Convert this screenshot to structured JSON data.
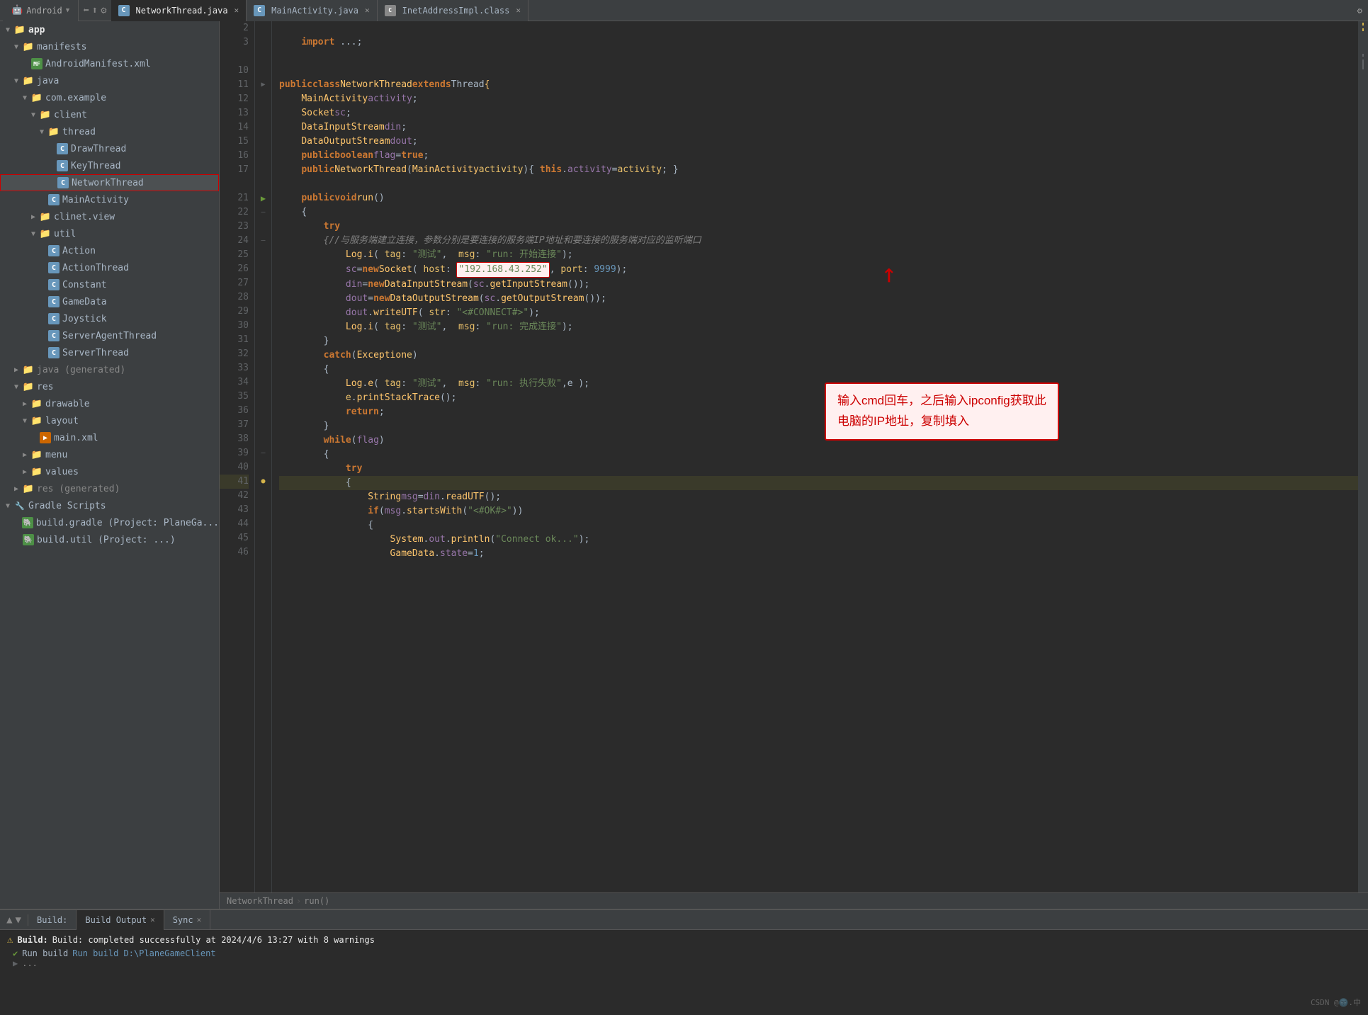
{
  "tabs": [
    {
      "label": "NetworkThread.java",
      "active": true,
      "icon": "java"
    },
    {
      "label": "MainActivity.java",
      "active": false,
      "icon": "java"
    },
    {
      "label": "InetAddressImpl.class",
      "active": false,
      "icon": "class"
    }
  ],
  "sidebar": {
    "title": "Android",
    "items": [
      {
        "level": 1,
        "type": "folder",
        "label": "app",
        "open": true,
        "bold": true
      },
      {
        "level": 2,
        "type": "folder",
        "label": "manifests",
        "open": true
      },
      {
        "level": 3,
        "type": "manifest",
        "label": "AndroidManifest.xml"
      },
      {
        "level": 2,
        "type": "folder",
        "label": "java",
        "open": true
      },
      {
        "level": 3,
        "type": "folder",
        "label": "com.example",
        "open": true
      },
      {
        "level": 4,
        "type": "folder",
        "label": "client",
        "open": true
      },
      {
        "level": 5,
        "type": "folder",
        "label": "thread",
        "open": true
      },
      {
        "level": 6,
        "type": "c",
        "label": "DrawThread"
      },
      {
        "level": 6,
        "type": "c",
        "label": "KeyThread"
      },
      {
        "level": 6,
        "type": "c",
        "label": "NetworkThread",
        "selected": true
      },
      {
        "level": 5,
        "type": "c",
        "label": "MainActivity"
      },
      {
        "level": 4,
        "type": "folder",
        "label": "clinet.view",
        "open": false
      },
      {
        "level": 4,
        "type": "folder",
        "label": "util",
        "open": true
      },
      {
        "level": 5,
        "type": "c",
        "label": "Action"
      },
      {
        "level": 5,
        "type": "c",
        "label": "ActionThread"
      },
      {
        "level": 5,
        "type": "c",
        "label": "Constant"
      },
      {
        "level": 5,
        "type": "c",
        "label": "GameData"
      },
      {
        "level": 5,
        "type": "c",
        "label": "Joystick"
      },
      {
        "level": 5,
        "type": "c",
        "label": "ServerAgentThread"
      },
      {
        "level": 5,
        "type": "c",
        "label": "ServerThread"
      },
      {
        "level": 2,
        "type": "folder",
        "label": "java (generated)",
        "open": false,
        "gray": true
      },
      {
        "level": 2,
        "type": "folder",
        "label": "res",
        "open": true
      },
      {
        "level": 3,
        "type": "folder",
        "label": "drawable",
        "open": false
      },
      {
        "level": 3,
        "type": "folder",
        "label": "layout",
        "open": true
      },
      {
        "level": 4,
        "type": "xml",
        "label": "main.xml"
      },
      {
        "level": 3,
        "type": "folder",
        "label": "menu",
        "open": false
      },
      {
        "level": 3,
        "type": "folder",
        "label": "values",
        "open": false
      },
      {
        "level": 2,
        "type": "folder",
        "label": "res (generated)",
        "open": false,
        "gray": true
      },
      {
        "level": 1,
        "type": "folder",
        "label": "Gradle Scripts",
        "open": true
      },
      {
        "level": 2,
        "type": "gradle",
        "label": "build.gradle (Project: PlaneGa..."
      },
      {
        "level": 2,
        "type": "gradle",
        "label": "build.util (Project: ...)"
      }
    ]
  },
  "code": {
    "filename": "NetworkThread.java",
    "lines": [
      {
        "n": 2,
        "text": ""
      },
      {
        "n": 3,
        "text": "    import ...;"
      },
      {
        "n": 10,
        "text": ""
      },
      {
        "n": 11,
        "text": "public class NetworkThread extends Thread{"
      },
      {
        "n": 12,
        "text": "    MainActivity activity;"
      },
      {
        "n": 13,
        "text": "    Socket sc;"
      },
      {
        "n": 14,
        "text": "    DataInputStream din;"
      },
      {
        "n": 15,
        "text": "    DataOutputStream dout;"
      },
      {
        "n": 16,
        "text": "    public boolean flag=true;"
      },
      {
        "n": 17,
        "text": "    public NetworkThread(MainActivity activity) { this.activity=activity; }"
      },
      {
        "n": 21,
        "text": "    public void run()"
      },
      {
        "n": 22,
        "text": "    {"
      },
      {
        "n": 23,
        "text": "        try"
      },
      {
        "n": 24,
        "text": "        {//与服务端建立连接，参数分别是要连接的服务端IP地址和要连接的服务端对应的监听端口"
      },
      {
        "n": 25,
        "text": "            Log.i( tag: \"测试\",  msg: \"run: 开始连接\");"
      },
      {
        "n": 26,
        "text": "            sc=new Socket( host: \"192.168.43.252\", port: 9999);"
      },
      {
        "n": 27,
        "text": "            din=new DataInputStream(sc.getInputStream());"
      },
      {
        "n": 28,
        "text": "            dout=new DataOutputStream(sc.getOutputStream());"
      },
      {
        "n": 29,
        "text": "            dout.writeUTF( str: \"<#CONNECT#>\");"
      },
      {
        "n": 30,
        "text": "            Log.i( tag: \"测试\",  msg: \"run: 完成连接\");"
      },
      {
        "n": 31,
        "text": "        }"
      },
      {
        "n": 32,
        "text": "        catch(Exception e)"
      },
      {
        "n": 33,
        "text": "        {"
      },
      {
        "n": 34,
        "text": "            Log.e( tag: \"测试\",  msg: \"run: 执行失败\",e );"
      },
      {
        "n": 35,
        "text": "            e.printStackTrace();"
      },
      {
        "n": 36,
        "text": "            return;"
      },
      {
        "n": 37,
        "text": "        }"
      },
      {
        "n": 38,
        "text": "        while(flag)"
      },
      {
        "n": 39,
        "text": "        {"
      },
      {
        "n": 40,
        "text": "            try"
      },
      {
        "n": 41,
        "text": "            {"
      },
      {
        "n": 42,
        "text": "                String msg=din.readUTF();"
      },
      {
        "n": 43,
        "text": "                if(msg.startsWith(\"<#OK#>\"))"
      },
      {
        "n": 44,
        "text": "                {"
      },
      {
        "n": 45,
        "text": "                    System.out.println(\"Connect ok...\");"
      },
      {
        "n": 46,
        "text": "                    GameData.state=1;"
      }
    ]
  },
  "breadcrumb": {
    "file": "NetworkThread",
    "method": "run()"
  },
  "bottomPanel": {
    "tabs": [
      {
        "label": "Build",
        "active": false
      },
      {
        "label": "Build Output",
        "active": true
      },
      {
        "label": "Sync",
        "active": false
      }
    ],
    "buildMessage": "Build: completed successfully at 2024/4/6 13:27  with 8 warnings",
    "runBuild": "Run build D:\\PlaneGameClient"
  },
  "annotation": {
    "text": "输入cmd回车，之后输入ipconfig获取此\n电脑的IP地址，复制填入"
  }
}
